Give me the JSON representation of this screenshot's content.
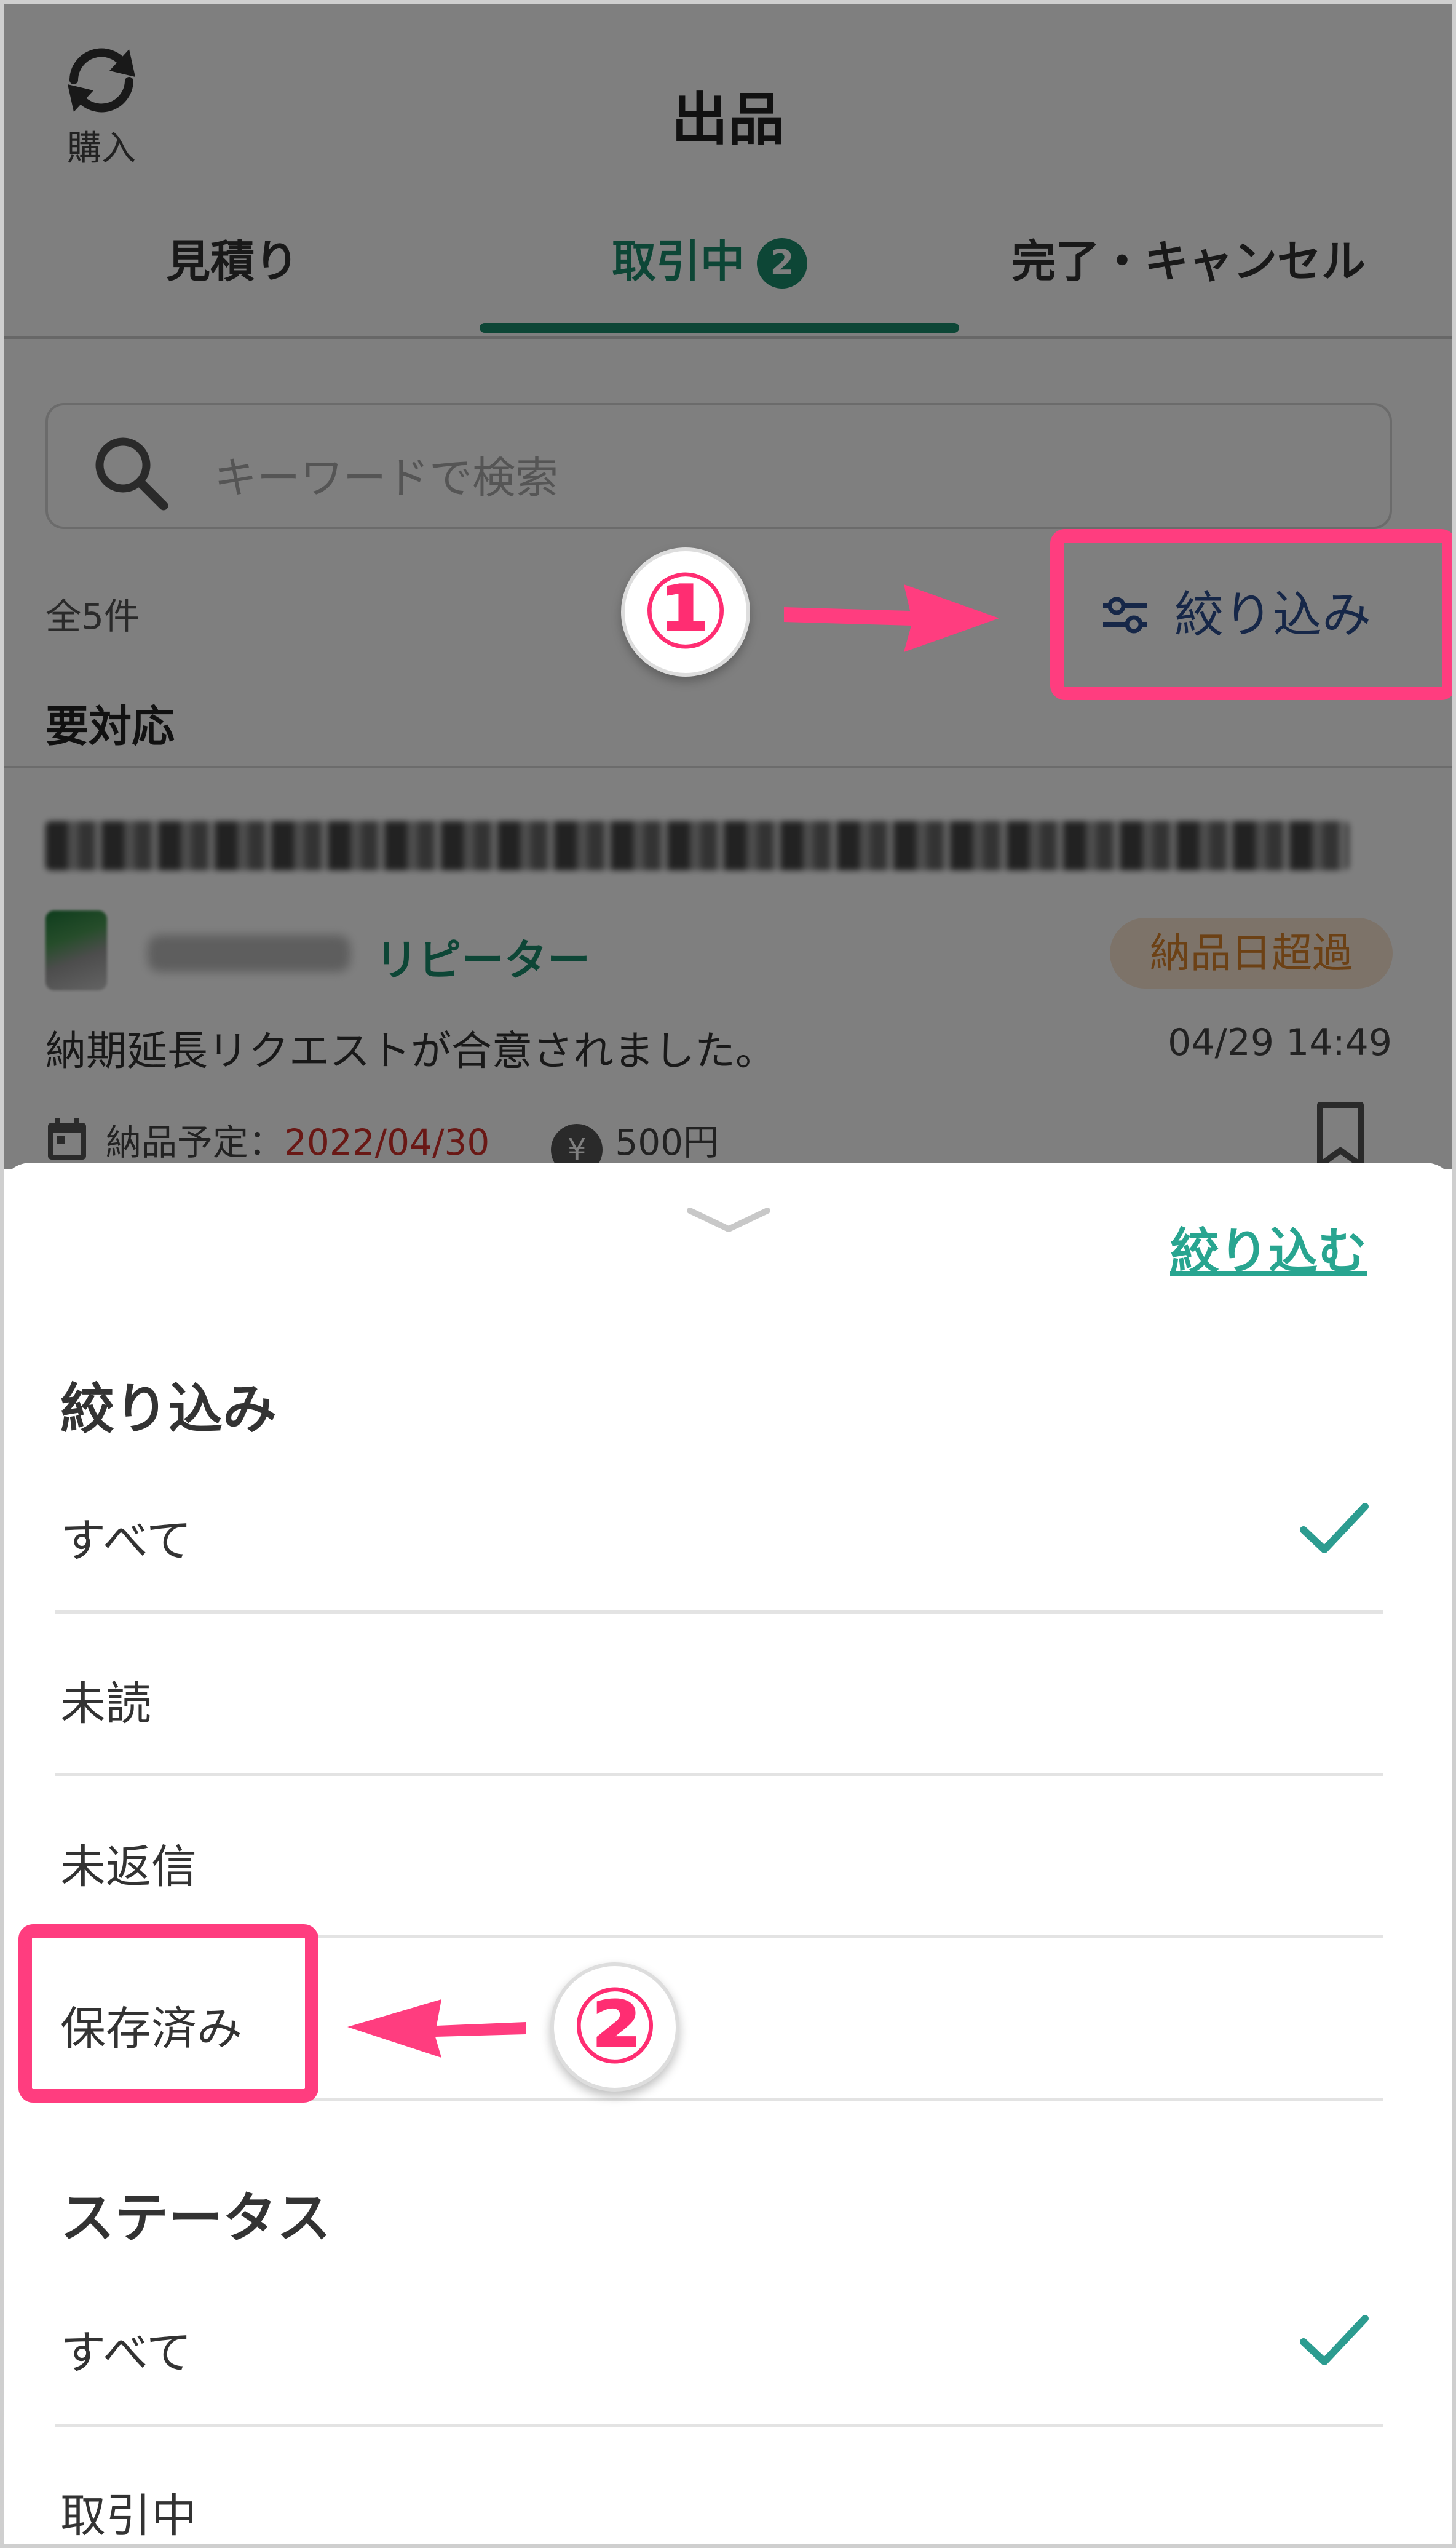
{
  "header": {
    "purchase_label": "購入",
    "title": "出品"
  },
  "tabs": [
    {
      "label": "見積り"
    },
    {
      "label": "取引中",
      "badge": "2"
    },
    {
      "label": "完了・キャンセル"
    }
  ],
  "search": {
    "placeholder": "キーワードで検索"
  },
  "list": {
    "count": "全5件",
    "filter_label": "絞り込み",
    "section": "要対応"
  },
  "item": {
    "buyer_type": "リピーター",
    "status_badge": "納品日超過",
    "message": "納期延長リクエストが合意されました。",
    "timestamp": "04/29 14:49",
    "delivery_label": "納品予定：",
    "delivery_date": "2022/04/30",
    "yen_symbol": "¥",
    "price": "500円"
  },
  "sheet": {
    "apply_label": "絞り込む",
    "filter_heading": "絞り込み",
    "filter_options": [
      "すべて",
      "未読",
      "未返信",
      "保存済み"
    ],
    "status_heading": "ステータス",
    "status_options": [
      "すべて",
      "取引中"
    ]
  },
  "annotations": {
    "step1": "①",
    "step2": "②"
  },
  "colors": {
    "accent_green": "#1a8d6d",
    "link_teal": "#28a590",
    "annotation_pink": "#ff3d7f"
  }
}
